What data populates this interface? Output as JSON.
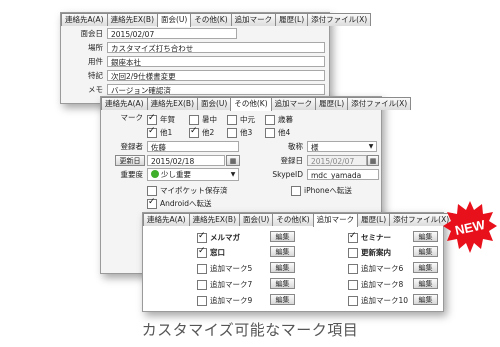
{
  "back_window": {
    "tabs": [
      "連絡先A(A)",
      "連絡先EX(B)",
      "面会(U)",
      "その他(K)",
      "追加マーク",
      "履歴(L)",
      "添付ファイル(X)"
    ],
    "fields": [
      {
        "label": "面会日",
        "value": "2015/02/07"
      },
      {
        "label": "場所",
        "value": "カスタマイズ打ち合わせ"
      },
      {
        "label": "用件",
        "value": "銀座本社"
      },
      {
        "label": "特記",
        "value": "次回2/9仕様書変更"
      },
      {
        "label": "メモ",
        "value": "バージョン確認済"
      }
    ]
  },
  "mid_window": {
    "tabs": [
      "連絡先A(A)",
      "連絡先EX(B)",
      "面会(U)",
      "その他(K)",
      "追加マーク",
      "履歴(L)",
      "添付ファイル(X)"
    ],
    "mark_label": "マーク",
    "marks_row1": [
      {
        "label": "年賀",
        "checked": true
      },
      {
        "label": "暑中",
        "checked": false
      },
      {
        "label": "中元",
        "checked": false
      },
      {
        "label": "歳暮",
        "checked": false
      }
    ],
    "marks_row2": [
      {
        "label": "他1",
        "checked": true
      },
      {
        "label": "他2",
        "checked": true
      },
      {
        "label": "他3",
        "checked": false
      },
      {
        "label": "他4",
        "checked": false
      }
    ],
    "registrant_label": "登録者",
    "registrant_value": "佐藤",
    "honorific_label": "敬称",
    "honorific_value": "様",
    "update_date_button": "更新日",
    "update_date_value": "2015/02/18",
    "register_date_label": "登録日",
    "register_date_value": "2015/02/07",
    "importance_label": "重要度",
    "importance_value": "少し重要",
    "skype_label": "SkypeID",
    "skype_value": "mdc_yamada",
    "mypocket_label": "マイポケット保存済",
    "mypocket_checked": false,
    "iphone_label": "iPhoneへ転送",
    "iphone_checked": false,
    "android_label": "Androidへ転送",
    "android_checked": true
  },
  "front_window": {
    "tabs": [
      "連絡先A(A)",
      "連絡先EX(B)",
      "面会(U)",
      "その他(K)",
      "追加マーク",
      "履歴(L)",
      "添付ファイル(X)"
    ],
    "edit_label": "編集",
    "marks_left": [
      {
        "label": "メルマガ",
        "checked": true,
        "bold": true
      },
      {
        "label": "窓口",
        "checked": true,
        "bold": true
      },
      {
        "label": "追加マーク5",
        "checked": false,
        "bold": false
      },
      {
        "label": "追加マーク7",
        "checked": false,
        "bold": false
      },
      {
        "label": "追加マーク9",
        "checked": false,
        "bold": false
      }
    ],
    "marks_right": [
      {
        "label": "セミナー",
        "checked": true,
        "bold": true
      },
      {
        "label": "更新案内",
        "checked": false,
        "bold": true
      },
      {
        "label": "追加マーク6",
        "checked": false,
        "bold": false
      },
      {
        "label": "追加マーク8",
        "checked": false,
        "bold": false
      },
      {
        "label": "追加マーク10",
        "checked": false,
        "bold": false
      }
    ]
  },
  "badge": {
    "text": "NEW",
    "color": "#e8101a"
  },
  "caption": "カスタマイズ可能なマーク項目"
}
